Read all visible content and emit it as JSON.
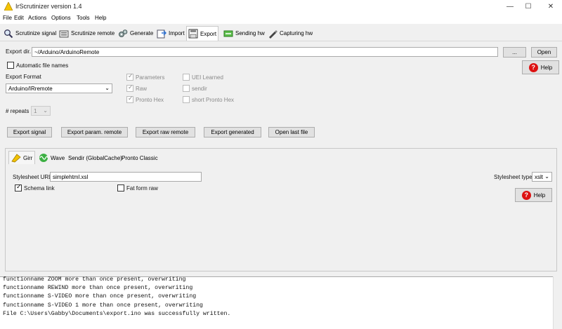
{
  "window": {
    "title": "IrScrutinizer version 1.4",
    "minimize_glyph": "—",
    "maximize_glyph": "☐",
    "close_glyph": "✕"
  },
  "menu": [
    "File",
    "Edit",
    "Actions",
    "Options",
    "Tools",
    "Help"
  ],
  "main_tabs": [
    {
      "label": "Scrutinize signal",
      "icon": "magnifier-icon"
    },
    {
      "label": "Scrutinize remote",
      "icon": "remote-icon"
    },
    {
      "label": "Generate",
      "icon": "gears-icon"
    },
    {
      "label": "Import",
      "icon": "import-icon"
    },
    {
      "label": "Export",
      "icon": "floppy-icon",
      "selected": true
    },
    {
      "label": "Sending hw",
      "icon": "send-icon"
    },
    {
      "label": "Capturing hw",
      "icon": "pen-icon"
    }
  ],
  "export": {
    "dir_label": "Export dir.",
    "dir_value": "~/Arduino/ArduinoRemote",
    "browse_label": "...",
    "open_label": "Open",
    "auto_names_label": "Automatic file names",
    "auto_names_checked": false,
    "help_label": "Help",
    "format_label": "Export Format",
    "format_value": "Arduino/IRremote",
    "options_left": [
      {
        "label": "Parameters",
        "checked": true
      },
      {
        "label": "Raw",
        "checked": true
      },
      {
        "label": "Pronto Hex",
        "checked": true
      }
    ],
    "options_right": [
      {
        "label": "UEI Learned",
        "checked": false
      },
      {
        "label": "sendir",
        "checked": false
      },
      {
        "label": "short Pronto Hex",
        "checked": false
      }
    ],
    "repeats_label": "# repeats",
    "repeats_value": "1",
    "buttons": [
      "Export signal",
      "Export param. remote",
      "Export raw remote",
      "Export generated",
      "Open last file"
    ]
  },
  "sub_tabs": [
    {
      "label": "Girr",
      "icon": "girr-icon",
      "selected": true
    },
    {
      "label": "Wave",
      "icon": "wave-icon"
    },
    {
      "label": "Sendir (GlobalCache)"
    },
    {
      "label": "Pronto Classic"
    }
  ],
  "girr": {
    "stylesheet_url_label": "Stylesheet URL",
    "stylesheet_url_value": "simplehtml.xsl",
    "stylesheet_type_label": "Stylesheet type",
    "stylesheet_type_value": "xslt",
    "schema_link_label": "Schema link",
    "schema_link_checked": true,
    "fat_form_label": "Fat form raw",
    "fat_form_checked": false,
    "help_label": "Help"
  },
  "log_lines": [
    "functionname ZOOM more than once present, overwriting",
    "functionname REWIND more than once present, overwriting",
    "functionname S-VIDEO more than once present, overwriting",
    "functionname S-VIDEO 1 more than once present, overwriting",
    "File C:\\Users\\Gabby\\Documents\\export.ino was successfully written."
  ],
  "colors": {
    "accent_selected_tab": "#ffffff",
    "help_red": "#d11111"
  }
}
